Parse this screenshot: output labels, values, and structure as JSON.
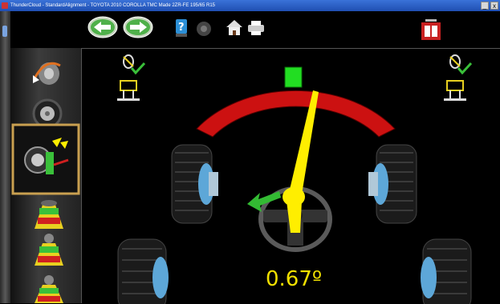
{
  "window": {
    "title": "ThunderCloud - StandardAlignment - TOYOTA 2010 COROLLA TMC Made 2ZR-FE 195/65 R15",
    "controls": [
      "_",
      "x"
    ]
  },
  "toolbar": {
    "back_icon": "left-arrow-icon",
    "forward_icon": "right-arrow-icon",
    "help_icon": "help-icon",
    "home_icon": "home-icon",
    "print_icon": "printer-icon",
    "ruler_icon": "red-ruler-icon"
  },
  "sidebar": {
    "logo": "alignment-logo",
    "items": [
      "wheel-turn-icon",
      "tire-icon",
      "caster-sweep-icon",
      "adjust-1-icon",
      "adjust-2-icon",
      "adjust-3-icon"
    ],
    "active_index": 2
  },
  "gauge": {
    "reading": "0.67º",
    "zone_colors": {
      "out": "#cc1111",
      "in": "#22dd22",
      "needle": "#ffee00",
      "arrow": "#33bb33"
    }
  }
}
